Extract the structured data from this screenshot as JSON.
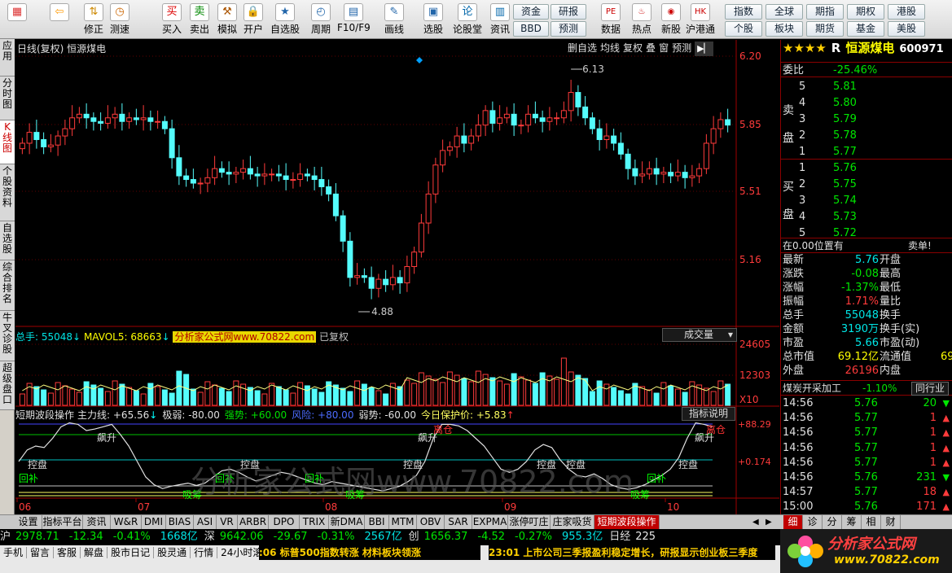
{
  "toolbar": {
    "buttons": [
      {
        "label": "",
        "icon": "home-icon"
      },
      {
        "label": "",
        "icon": "back-icon"
      },
      {
        "label": "修正",
        "icon": "arrow-updown-icon"
      },
      {
        "label": "测速",
        "icon": "clock-icon"
      },
      {
        "label": "买入",
        "icon": "buy-icon",
        "glyph": "买"
      },
      {
        "label": "卖出",
        "icon": "sell-icon",
        "glyph": "卖"
      },
      {
        "label": "模拟",
        "icon": "hammer-icon"
      },
      {
        "label": "开户",
        "icon": "lock-icon"
      },
      {
        "label": "自选股",
        "icon": "star-icon"
      },
      {
        "label": "周期",
        "icon": "cycle-icon"
      },
      {
        "label": "F10/F9",
        "icon": "f10-icon"
      },
      {
        "label": "画线",
        "icon": "pen-icon"
      },
      {
        "label": "选股",
        "icon": "screen-icon"
      },
      {
        "label": "论股堂",
        "icon": "forum-icon",
        "glyph": "论"
      },
      {
        "label": "资讯",
        "icon": "news-icon"
      }
    ],
    "quick1": [
      "资金",
      "研报",
      "BBD",
      "预测"
    ],
    "quick2": [
      {
        "label": "数据",
        "icon": "pe-icon"
      },
      {
        "label": "热点",
        "icon": "hot-icon"
      },
      {
        "label": "新股",
        "icon": "newstock-icon"
      },
      {
        "label": "沪港通",
        "icon": "hk-icon"
      }
    ],
    "quick3": [
      "指数",
      "全球",
      "期指",
      "期权",
      "港股",
      "个股",
      "板块",
      "期货",
      "基金",
      "美股"
    ]
  },
  "vtabs": [
    "应用",
    "分时图",
    "K线图",
    "个股资料",
    "自选股",
    "综合排名",
    "牛叉诊股",
    "超级盘口"
  ],
  "chart": {
    "header_left": "日线(复权) 恒源煤电",
    "header_buttons": [
      "删自选",
      "均线",
      "复权",
      "叠",
      "窗",
      "预测"
    ],
    "price_ticks": [
      "6.20",
      "5.85",
      "5.51",
      "5.16"
    ],
    "high_label": "6.13",
    "low_label": "4.88",
    "vol_info": {
      "zongshou_label": "总手: ",
      "zongshou": "55048",
      "mavol_label": "MAVOL5: ",
      "mavol": "68663",
      "watermark": "分析家公式网www.70822.com",
      "suffix": "已复权"
    },
    "vol_ticks": [
      "24605",
      "12303",
      "X10"
    ],
    "vol_dropdown": "成交量",
    "ind_info": {
      "name": "短期波段操作",
      "items": [
        {
          "label": "主力线: ",
          "value": "+65.56"
        },
        {
          "label": "极弱: ",
          "value": "-80.00"
        },
        {
          "label": "强势: ",
          "value": "+60.00"
        },
        {
          "label": "风险: ",
          "value": "+80.00"
        },
        {
          "label": "弱势: ",
          "value": "-60.00"
        },
        {
          "label": "今日保护价: ",
          "value": "+5.83"
        }
      ],
      "explain": "指标说明"
    },
    "ind_ticks": [
      "+88.29",
      "+0.174"
    ],
    "ind_labels": [
      "飙升",
      "控盘",
      "回补",
      "吸筹",
      "离仓"
    ],
    "big_watermark": "分析家公式网www.70822.com",
    "months": [
      "06",
      "07",
      "08",
      "09",
      "10"
    ]
  },
  "quote": {
    "stars": "★★★★",
    "r": "R",
    "name": "恒源煤电",
    "code": "600971",
    "weibi_label": "委比",
    "weibi": "-25.46%",
    "sell_label": "卖盘",
    "buy_label": "买盘",
    "asks": [
      {
        "lv": "5",
        "p": "5.81"
      },
      {
        "lv": "4",
        "p": "5.80"
      },
      {
        "lv": "3",
        "p": "5.79"
      },
      {
        "lv": "2",
        "p": "5.78"
      },
      {
        "lv": "1",
        "p": "5.77"
      }
    ],
    "bids": [
      {
        "lv": "1",
        "p": "5.76"
      },
      {
        "lv": "2",
        "p": "5.75"
      },
      {
        "lv": "3",
        "p": "5.74"
      },
      {
        "lv": "4",
        "p": "5.73"
      },
      {
        "lv": "5",
        "p": "5.72"
      }
    ],
    "pos_left": "在0.00位置有",
    "pos_right": "卖单!",
    "stats": [
      {
        "k": "最新",
        "v": "5.76",
        "k2": "开盘"
      },
      {
        "k": "涨跌",
        "v": "-0.08",
        "k2": "最高"
      },
      {
        "k": "涨幅",
        "v": "-1.37%",
        "k2": "最低"
      },
      {
        "k": "振幅",
        "v": "1.71%",
        "k2": "量比"
      },
      {
        "k": "总手",
        "v": "55048",
        "k2": "换手"
      },
      {
        "k": "金额",
        "v": "3190万",
        "k2": "换手(实)"
      },
      {
        "k": "市盈",
        "v": "5.66",
        "k2": "市盈(动)"
      },
      {
        "k": "总市值",
        "v": "69.12亿",
        "k2": "流通值",
        "v2": "69"
      },
      {
        "k": "外盘",
        "v": "26196",
        "k2": "内盘"
      }
    ],
    "industry": "煤炭开采加工",
    "industry_pct": "-1.10%",
    "industry_btn": "同行业",
    "ticks": [
      {
        "t": "14:56",
        "p": "5.76",
        "v": "20",
        "d": "down"
      },
      {
        "t": "14:56",
        "p": "5.77",
        "v": "1",
        "d": "up"
      },
      {
        "t": "14:56",
        "p": "5.77",
        "v": "1",
        "d": "up"
      },
      {
        "t": "14:56",
        "p": "5.77",
        "v": "1",
        "d": "up"
      },
      {
        "t": "14:56",
        "p": "5.77",
        "v": "1",
        "d": "up"
      },
      {
        "t": "14:56",
        "p": "5.76",
        "v": "231",
        "d": "down"
      },
      {
        "t": "14:57",
        "p": "5.77",
        "v": "18",
        "d": "up"
      },
      {
        "t": "15:00",
        "p": "5.76",
        "v": "171",
        "d": "up"
      }
    ]
  },
  "bottom_tabs": [
    "设置",
    "指标平台",
    "资讯",
    "W&R",
    "DMI",
    "BIAS",
    "ASI",
    "VR",
    "ARBR",
    "DPO",
    "TRIX",
    "新DMA",
    "BBI",
    "MTM",
    "OBV",
    "SAR",
    "EXPMA",
    "涨停叮庄",
    "庄家吸货",
    "短期波段操作"
  ],
  "right_tabs": [
    "细",
    "诊",
    "分",
    "筹",
    "相",
    "财"
  ],
  "index_bar": [
    {
      "name": "沪",
      "val": "2978.71",
      "chg": "-12.34",
      "pct": "-0.41%",
      "amt": "1668亿"
    },
    {
      "name": "深",
      "val": "9642.06",
      "chg": "-29.67",
      "pct": "-0.31%",
      "amt": "2567亿"
    },
    {
      "name": "创",
      "val": "1656.37",
      "chg": "-4.52",
      "pct": "-0.27%",
      "amt": "955.3亿"
    },
    {
      "name": "日经",
      "val": "225"
    }
  ],
  "status_bar": {
    "items": [
      "手机",
      "留言",
      "客服",
      "解盘",
      "股市日记",
      "股灵通",
      "行情",
      "24小时滚动"
    ],
    "news1": ":06 标普500指数转涨 材料板块领涨",
    "news2": "23:01 上市公司三季报盈利稳定增长，研报显示创业板三季度"
  },
  "logo": {
    "text": "分析家公式网",
    "url": "www.70822.com"
  }
}
